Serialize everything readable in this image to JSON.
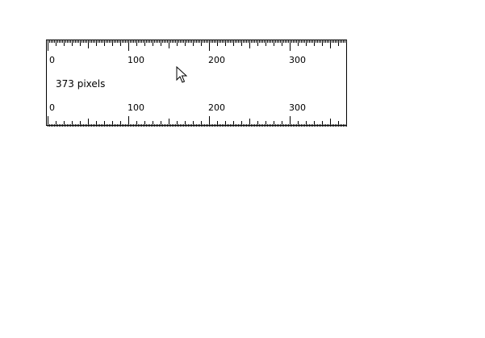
{
  "ruler": {
    "measurement_label": "373 pixels",
    "top_scale_labels": [
      "0",
      "100",
      "200",
      "300"
    ],
    "bottom_scale_labels": [
      "0",
      "100",
      "200",
      "300"
    ],
    "background_color": "#ffffff",
    "tick_color": "#000000"
  },
  "cursor": {
    "icon": "arrow-pointer-icon"
  }
}
